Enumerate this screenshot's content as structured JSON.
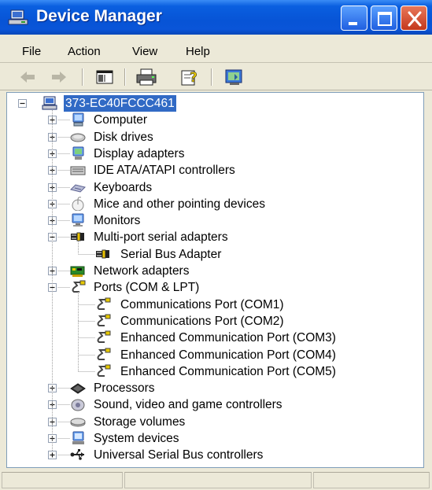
{
  "window": {
    "title": "Device Manager",
    "colors": {
      "titlebar": "#0754d6",
      "selection": "#316ac5",
      "close_button": "#c4381c"
    }
  },
  "menu": {
    "items": [
      "File",
      "Action",
      "View",
      "Help"
    ]
  },
  "toolbar": {
    "icons": [
      "back-arrow-icon",
      "forward-arrow-icon",
      "show-hide-console-tree-icon",
      "print-icon",
      "help-icon",
      "properties-icon"
    ]
  },
  "tree": {
    "root": {
      "label": "373-EC40FCCC461",
      "expanded": true,
      "selected": true
    },
    "nodes": [
      {
        "label": "Computer",
        "icon": "computer-icon",
        "expanded": false
      },
      {
        "label": "Disk drives",
        "icon": "disk-drive-icon",
        "expanded": false
      },
      {
        "label": "Display adapters",
        "icon": "display-adapter-icon",
        "expanded": false
      },
      {
        "label": "IDE ATA/ATAPI controllers",
        "icon": "ide-controller-icon",
        "expanded": false
      },
      {
        "label": "Keyboards",
        "icon": "keyboard-icon",
        "expanded": false
      },
      {
        "label": "Mice and other pointing devices",
        "icon": "mouse-icon",
        "expanded": false
      },
      {
        "label": "Monitors",
        "icon": "monitor-icon",
        "expanded": false
      },
      {
        "label": "Multi-port serial adapters",
        "icon": "serial-adapter-icon",
        "expanded": true,
        "children": [
          {
            "label": "Serial Bus Adapter",
            "icon": "serial-adapter-icon"
          }
        ]
      },
      {
        "label": "Network adapters",
        "icon": "network-adapter-icon",
        "expanded": false
      },
      {
        "label": "Ports (COM & LPT)",
        "icon": "port-icon",
        "expanded": true,
        "children": [
          {
            "label": "Communications Port (COM1)",
            "icon": "port-icon"
          },
          {
            "label": "Communications Port (COM2)",
            "icon": "port-icon"
          },
          {
            "label": "Enhanced Communication Port (COM3)",
            "icon": "port-icon"
          },
          {
            "label": "Enhanced Communication Port (COM4)",
            "icon": "port-icon"
          },
          {
            "label": "Enhanced Communication Port (COM5)",
            "icon": "port-icon"
          }
        ]
      },
      {
        "label": "Processors",
        "icon": "processor-icon",
        "expanded": false
      },
      {
        "label": "Sound, video and game controllers",
        "icon": "sound-icon",
        "expanded": false
      },
      {
        "label": "Storage volumes",
        "icon": "storage-volume-icon",
        "expanded": false
      },
      {
        "label": "System devices",
        "icon": "system-device-icon",
        "expanded": false
      },
      {
        "label": "Universal Serial Bus controllers",
        "icon": "usb-icon",
        "expanded": false
      }
    ]
  }
}
